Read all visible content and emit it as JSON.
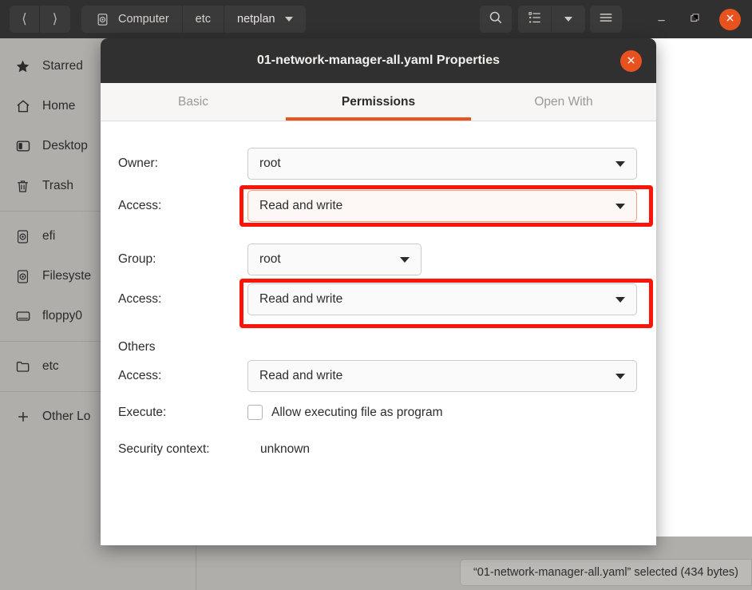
{
  "window": {
    "nav": {
      "back_icon": "chevron-left-icon",
      "forward_icon": "chevron-right-icon"
    },
    "breadcrumb": [
      {
        "label": "Computer",
        "icon": "drive-icon",
        "has_menu": false
      },
      {
        "label": "etc",
        "icon": "",
        "has_menu": false
      },
      {
        "label": "netplan",
        "icon": "",
        "has_menu": true
      }
    ],
    "toolbar": {
      "search_icon": "search-icon",
      "view_list_icon": "list-view-icon",
      "view_menu_icon": "chevron-down-icon",
      "hamburger_icon": "hamburger-menu-icon"
    },
    "controls": {
      "minimize_icon": "minimize-icon",
      "maximize_icon": "restore-icon",
      "close_icon": "close-icon"
    },
    "statusbar": {
      "text": "“01-network-manager-all.yaml” selected  (434 bytes)"
    }
  },
  "sidebar": {
    "groups": [
      {
        "items": [
          {
            "label": "Starred",
            "icon": "star-icon"
          },
          {
            "label": "Home",
            "icon": "home-icon"
          },
          {
            "label": "Desktop",
            "icon": "desktop-icon"
          },
          {
            "label": "Trash",
            "icon": "trash-icon"
          }
        ]
      },
      {
        "items": [
          {
            "label": "efi",
            "icon": "drive-icon"
          },
          {
            "label": "Filesyste",
            "icon": "drive-icon"
          },
          {
            "label": "floppy0",
            "icon": "floppy-icon"
          }
        ]
      },
      {
        "items": [
          {
            "label": "etc",
            "icon": "folder-icon"
          }
        ]
      },
      {
        "items": [
          {
            "label": "Other Lo",
            "icon": "plus-icon"
          }
        ]
      }
    ]
  },
  "dialog": {
    "title": "01-network-manager-all.yaml Properties",
    "close_icon": "close-icon",
    "tabs": [
      {
        "label": "Basic",
        "active": false
      },
      {
        "label": "Permissions",
        "active": true
      },
      {
        "label": "Open With",
        "active": false
      }
    ],
    "fields": {
      "owner_label": "Owner:",
      "owner_value": "root",
      "owner_access_label": "Access:",
      "owner_access_value": "Read and write",
      "group_label": "Group:",
      "group_value": "root",
      "group_access_label": "Access:",
      "group_access_value": "Read and write",
      "others_label": "Others",
      "others_access_label": "Access:",
      "others_access_value": "Read and write",
      "execute_label": "Execute:",
      "execute_checkbox_label": "Allow executing file as program",
      "security_context_label": "Security context:",
      "security_context_value": "unknown"
    }
  },
  "colors": {
    "accent": "#e8521f",
    "highlight_box": "#fb1409",
    "header_bg": "#303030",
    "sidebar_bg": "#b0aeab"
  }
}
